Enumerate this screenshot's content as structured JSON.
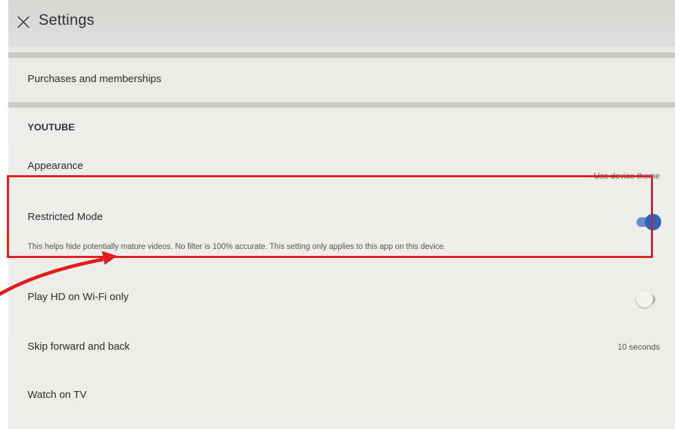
{
  "header": {
    "title": "Settings",
    "close_icon": "close-icon"
  },
  "rows": {
    "purchases": {
      "label": "Purchases and memberships"
    },
    "section_youtube": "YOUTUBE",
    "appearance": {
      "label": "Appearance",
      "value": "Use device theme"
    },
    "restricted": {
      "label": "Restricted Mode",
      "description": "This helps hide potentially mature videos. No filter is 100% accurate. This setting only applies to this app on this device.",
      "enabled": true
    },
    "play_hd": {
      "label": "Play HD on Wi-Fi only",
      "enabled": false
    },
    "skip": {
      "label": "Skip forward and back",
      "value": "10 seconds"
    },
    "watch_tv": {
      "label": "Watch on TV"
    }
  },
  "annotation": {
    "color": "#e31b1b"
  },
  "colors": {
    "toggle_on": "#2f64b8",
    "toggle_track_on": "#6d8fc9",
    "toggle_off": "#bdbdbb"
  }
}
